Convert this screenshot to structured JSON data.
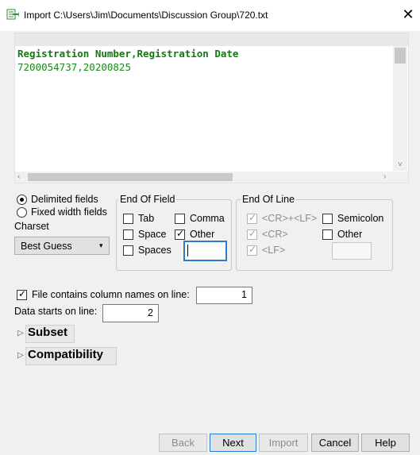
{
  "window": {
    "title": "Import C:\\Users\\Jim\\Documents\\Discussion Group\\720.txt",
    "close_glyph": "✕",
    "icon": "data-import-icon"
  },
  "preview": {
    "lines": [
      "Registration Number,Registration Date",
      "7200054737,20200825"
    ]
  },
  "format": {
    "delimited_label": "Delimited fields",
    "fixed_label": "Fixed width fields",
    "selected": "Delimited fields"
  },
  "charset": {
    "label": "Charset",
    "value": "Best Guess"
  },
  "end_of_field": {
    "title": "End Of Field",
    "tab": "Tab",
    "comma": "Comma",
    "space": "Space",
    "other": "Other",
    "spaces": "Spaces",
    "checked": [
      "Other"
    ],
    "other_value": ""
  },
  "end_of_line": {
    "title": "End Of Line",
    "crlf": "<CR>+<LF>",
    "cr": "<CR>",
    "lf": "<LF>",
    "semicolon": "Semicolon",
    "other": "Other",
    "checked_disabled": [
      "<CR>+<LF>",
      "<CR>",
      "<LF>"
    ],
    "other_value": ""
  },
  "header_options": {
    "column_names_label": "File contains column names on line:",
    "column_names_checked": true,
    "column_names_line": "1",
    "data_starts_label": "Data starts on line:",
    "data_starts_line": "2"
  },
  "sections": {
    "subset": "Subset",
    "compatibility": "Compatibility"
  },
  "buttons": {
    "back": "Back",
    "next": "Next",
    "import": "Import",
    "cancel": "Cancel",
    "help": "Help"
  },
  "colors": {
    "preview_header_text": "#117a11",
    "preview_body_text": "#1a8a1a",
    "focus_border": "#2a7bd4"
  }
}
